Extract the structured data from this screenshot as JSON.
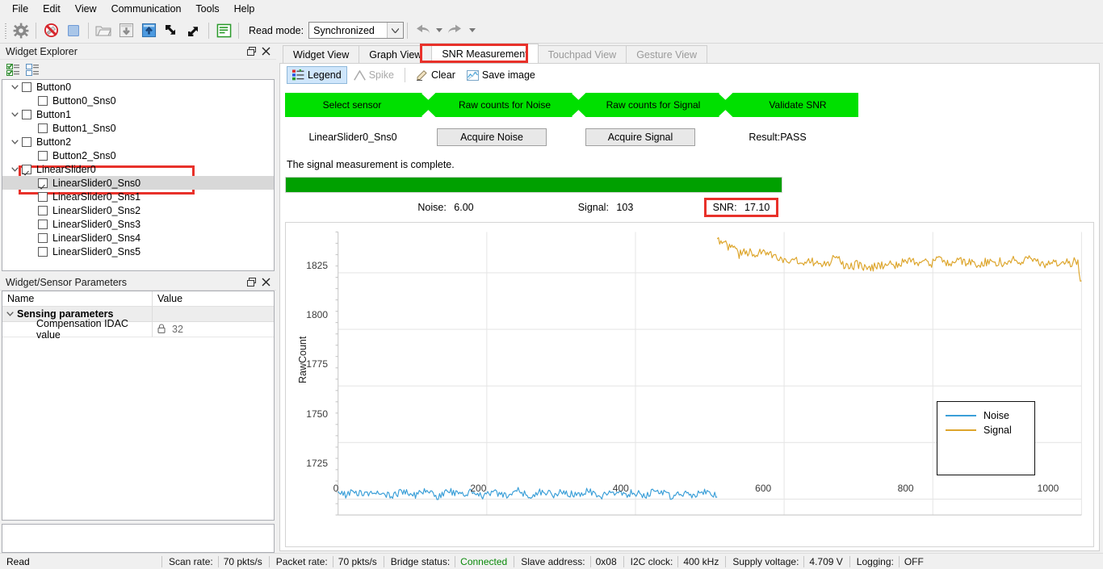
{
  "menubar": [
    "File",
    "Edit",
    "View",
    "Communication",
    "Tools",
    "Help"
  ],
  "toolbar": {
    "icons": [
      "settings-gear-icon",
      "disconnect-icon",
      "stop-icon",
      "open-folder-icon",
      "download-icon",
      "upload-icon",
      "import-icon",
      "export-icon",
      "log-icon"
    ],
    "read_mode_label": "Read mode:",
    "read_mode_value": "Synchronized",
    "undo_label": "undo-icon",
    "redo_label": "redo-icon"
  },
  "widget_explorer": {
    "title": "Widget Explorer",
    "toolbar": [
      "check-all-icon",
      "uncheck-all-icon"
    ],
    "tree": [
      {
        "label": "Button0",
        "level": 0,
        "checked": false,
        "expanded": true,
        "selected": false
      },
      {
        "label": "Button0_Sns0",
        "level": 1,
        "checked": false,
        "expanded": null,
        "selected": false
      },
      {
        "label": "Button1",
        "level": 0,
        "checked": false,
        "expanded": true,
        "selected": false
      },
      {
        "label": "Button1_Sns0",
        "level": 1,
        "checked": false,
        "expanded": null,
        "selected": false
      },
      {
        "label": "Button2",
        "level": 0,
        "checked": false,
        "expanded": true,
        "selected": false
      },
      {
        "label": "Button2_Sns0",
        "level": 1,
        "checked": false,
        "expanded": null,
        "selected": false
      },
      {
        "label": "LinearSlider0",
        "level": 0,
        "checked": true,
        "expanded": true,
        "selected": false
      },
      {
        "label": "LinearSlider0_Sns0",
        "level": 1,
        "checked": true,
        "expanded": null,
        "selected": true
      },
      {
        "label": "LinearSlider0_Sns1",
        "level": 1,
        "checked": false,
        "expanded": null,
        "selected": false
      },
      {
        "label": "LinearSlider0_Sns2",
        "level": 1,
        "checked": false,
        "expanded": null,
        "selected": false
      },
      {
        "label": "LinearSlider0_Sns3",
        "level": 1,
        "checked": false,
        "expanded": null,
        "selected": false
      },
      {
        "label": "LinearSlider0_Sns4",
        "level": 1,
        "checked": false,
        "expanded": null,
        "selected": false
      },
      {
        "label": "LinearSlider0_Sns5",
        "level": 1,
        "checked": false,
        "expanded": null,
        "selected": false
      }
    ]
  },
  "params_panel": {
    "title": "Widget/Sensor Parameters",
    "columns": [
      "Name",
      "Value"
    ],
    "rows": [
      {
        "name": "Sensing parameters",
        "value": "",
        "group": true
      },
      {
        "name": "Compensation IDAC value",
        "value": "32",
        "group": false,
        "locked": true
      }
    ]
  },
  "tabs": [
    {
      "label": "Widget View",
      "active": false,
      "disabled": false
    },
    {
      "label": "Graph View",
      "active": false,
      "disabled": false
    },
    {
      "label": "SNR Measurement",
      "active": true,
      "disabled": false
    },
    {
      "label": "Touchpad View",
      "active": false,
      "disabled": true
    },
    {
      "label": "Gesture View",
      "active": false,
      "disabled": true
    }
  ],
  "chart_toolbar": [
    {
      "label": "Legend",
      "icon": "legend-icon",
      "state": "on"
    },
    {
      "label": "Spike",
      "icon": "spike-icon",
      "state": "disabled"
    },
    {
      "label": "Clear",
      "icon": "clear-icon",
      "state": "normal"
    },
    {
      "label": "Save image",
      "icon": "save-image-icon",
      "state": "normal"
    }
  ],
  "wizard": {
    "steps": [
      "Select sensor",
      "Raw counts for Noise",
      "Raw counts for Signal",
      "Validate SNR"
    ],
    "color": "#00e000"
  },
  "actions": {
    "sensor_name": "LinearSlider0_Sns0",
    "acquire_noise_label": "Acquire Noise",
    "acquire_signal_label": "Acquire Signal",
    "result_label": "Result:PASS"
  },
  "status": {
    "message": "The signal measurement is complete.",
    "progress_percent": 100,
    "progress_color": "#00a000",
    "noise_label": "Noise:",
    "noise_value": "6.00",
    "signal_label": "Signal:",
    "signal_value": "103",
    "snr_label": "SNR:",
    "snr_value": "17.10",
    "highlight_color": "#e8312a"
  },
  "chart_data": {
    "type": "line",
    "title": "",
    "xlabel": "",
    "ylabel": "RawCount",
    "xlim": [
      0,
      1000
    ],
    "ylim": [
      1718,
      1843
    ],
    "xticks": [
      0,
      200,
      400,
      600,
      800,
      1000
    ],
    "yticks": [
      1725,
      1750,
      1775,
      1800,
      1825
    ],
    "grid": true,
    "legend_position": "bottom-right",
    "series": [
      {
        "name": "Noise",
        "color": "#3b9fd8",
        "x_range": [
          0,
          510
        ],
        "mean": 1727,
        "noise_amplitude": 3,
        "values": [
          1727.6,
          1726.7,
          1728.3,
          1727.2,
          1726.4,
          1728.8,
          1727.0,
          1726.2,
          1728.1,
          1727.9,
          1726.5,
          1728.4,
          1727.3,
          1726.0,
          1729.2,
          1727.6,
          1726.8,
          1728.0,
          1727.4,
          1726.3,
          1728.6,
          1727.1,
          1726.9,
          1728.9,
          1727.5,
          1726.1,
          1728.2,
          1727.8,
          1726.6,
          1728.7,
          1727.2,
          1726.4,
          1728.5,
          1727.7,
          1726.0,
          1729.0,
          1727.3,
          1726.7,
          1728.1,
          1727.0,
          1726.5,
          1728.8,
          1727.6,
          1726.2,
          1728.3,
          1727.4,
          1726.9,
          1728.6,
          1727.1,
          1726.3
        ]
      },
      {
        "name": "Signal",
        "color": "#dda52b",
        "x_range": [
          510,
          1000
        ],
        "start_value": 1840,
        "end_value": 1829,
        "values": [
          1840,
          1839,
          1838,
          1836,
          1837,
          1835,
          1833,
          1834,
          1833,
          1834,
          1833,
          1834,
          1834,
          1833,
          1834,
          1833,
          1832,
          1831,
          1830,
          1829,
          1829,
          1830,
          1830,
          1829,
          1830,
          1831,
          1830,
          1829,
          1830,
          1829,
          1828,
          1830,
          1832,
          1831,
          1829,
          1828,
          1827,
          1828,
          1829,
          1828,
          1827,
          1826,
          1827,
          1828,
          1829,
          1828,
          1829,
          1830,
          1829,
          1828,
          1829,
          1830,
          1831,
          1830,
          1829,
          1830,
          1831,
          1830,
          1829,
          1830,
          1831,
          1830,
          1829,
          1830,
          1829,
          1830,
          1831,
          1830,
          1829,
          1830,
          1829,
          1828,
          1829,
          1830,
          1829,
          1830,
          1829,
          1830,
          1829,
          1830,
          1831,
          1830,
          1829,
          1830,
          1831,
          1832,
          1831,
          1830,
          1829,
          1828,
          1829,
          1830,
          1829,
          1830,
          1831,
          1830,
          1829,
          1830,
          1829,
          1820
        ]
      }
    ]
  },
  "statusbar": {
    "read_state": "Read",
    "items": [
      {
        "key": "Scan rate:",
        "value": "70 pkts/s",
        "green": false
      },
      {
        "key": "Packet rate:",
        "value": "70 pkts/s",
        "green": false
      },
      {
        "key": "Bridge status:",
        "value": "Connected",
        "green": true
      },
      {
        "key": "Slave address:",
        "value": "0x08",
        "green": false
      },
      {
        "key": "I2C clock:",
        "value": "400 kHz",
        "green": false
      },
      {
        "key": "Supply voltage:",
        "value": "4.709 V",
        "green": false
      },
      {
        "key": "Logging:",
        "value": "OFF",
        "green": false
      }
    ]
  }
}
